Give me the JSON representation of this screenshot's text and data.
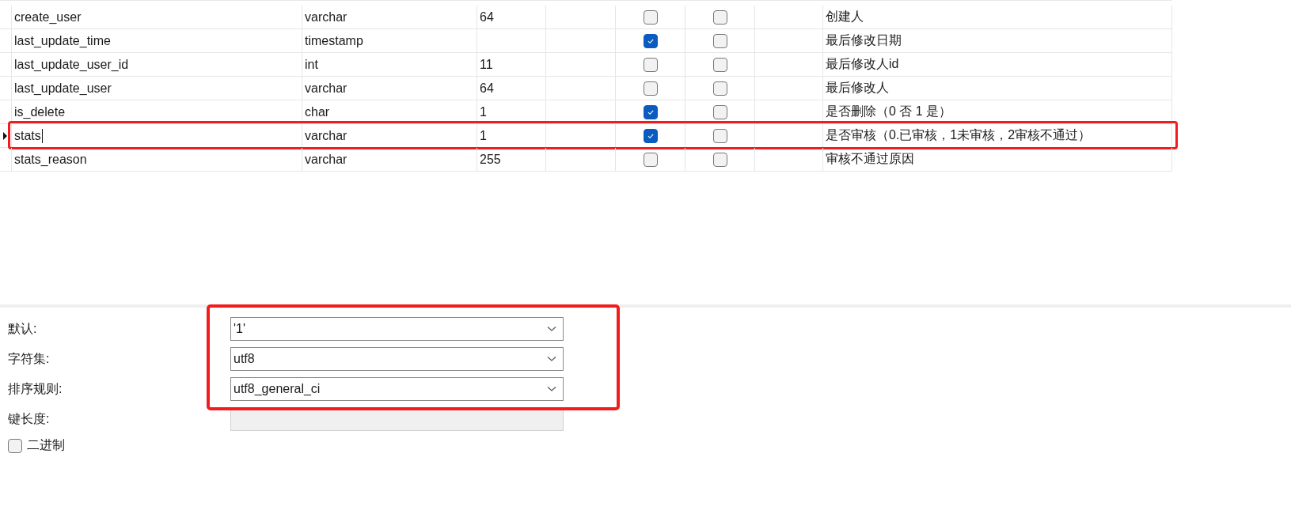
{
  "fields_table": {
    "rows": [
      {
        "name": "create_user",
        "type": "varchar",
        "length": "64",
        "not_null": false,
        "virtual": false,
        "comment": "创建人",
        "current": false,
        "highlighted": false
      },
      {
        "name": "last_update_time",
        "type": "timestamp",
        "length": "",
        "not_null": true,
        "virtual": false,
        "comment": "最后修改日期",
        "current": false,
        "highlighted": false
      },
      {
        "name": "last_update_user_id",
        "type": "int",
        "length": "11",
        "not_null": false,
        "virtual": false,
        "comment": "最后修改人id",
        "current": false,
        "highlighted": false
      },
      {
        "name": "last_update_user",
        "type": "varchar",
        "length": "64",
        "not_null": false,
        "virtual": false,
        "comment": "最后修改人",
        "current": false,
        "highlighted": false
      },
      {
        "name": "is_delete",
        "type": "char",
        "length": "1",
        "not_null": true,
        "virtual": false,
        "comment": "是否删除（0 否 1 是）",
        "current": false,
        "highlighted": false
      },
      {
        "name": "stats",
        "type": "varchar",
        "length": "1",
        "not_null": true,
        "virtual": false,
        "comment": "是否审核（0.已审核，1未审核，2审核不通过）",
        "current": true,
        "highlighted": true
      },
      {
        "name": "stats_reason",
        "type": "varchar",
        "length": "255",
        "not_null": false,
        "virtual": false,
        "comment": "审核不通过原因",
        "current": false,
        "highlighted": false
      }
    ]
  },
  "properties": {
    "highlighted": true,
    "fields": [
      {
        "kind": "select",
        "label": "默认:",
        "value": "'1'"
      },
      {
        "kind": "select",
        "label": "字符集:",
        "value": "utf8"
      },
      {
        "kind": "select",
        "label": "排序规则:",
        "value": "utf8_general_ci"
      },
      {
        "kind": "disabled",
        "label": "键长度:"
      }
    ],
    "binary": {
      "label": "二进制",
      "checked": false
    }
  }
}
